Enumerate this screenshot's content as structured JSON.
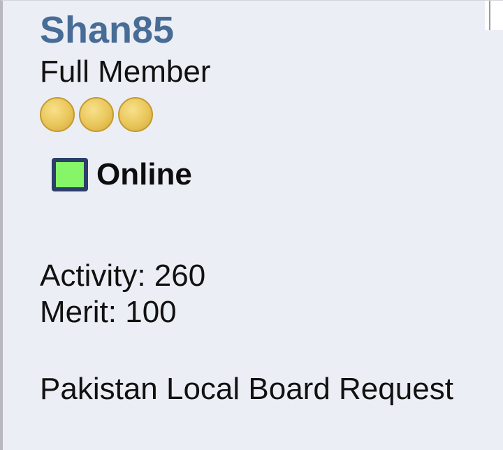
{
  "profile": {
    "username": "Shan85",
    "rank": "Full Member",
    "rank_coins": 3,
    "status": "Online",
    "status_color": "#86f568",
    "username_color": "#476c96",
    "activity_label": "Activity: 260",
    "merit_label": "Merit: 100",
    "board_request": "Pakistan Local Board Request"
  },
  "icons": {
    "coin": "gold-coin-icon",
    "status": "online-indicator-icon"
  }
}
